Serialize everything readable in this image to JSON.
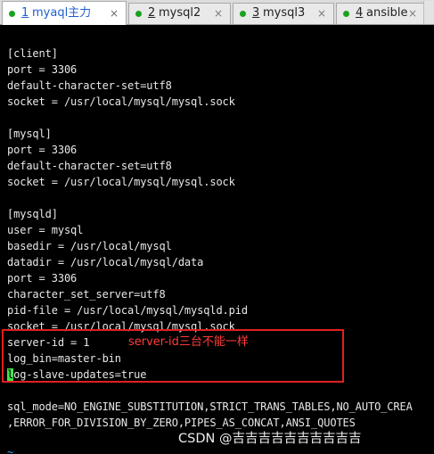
{
  "tabs": [
    {
      "number": "1",
      "label": "myaql主力",
      "active": true,
      "has_close": true
    },
    {
      "number": "2",
      "label": "mysql2",
      "active": false,
      "has_close": true
    },
    {
      "number": "3",
      "label": "mysql3",
      "active": false,
      "has_close": true
    },
    {
      "number": "4",
      "label": "ansible",
      "active": false,
      "has_close": true
    }
  ],
  "tab_close_glyph": "×",
  "status_color": "#1ba21b",
  "terminal": {
    "lines": [
      "[client]",
      "port = 3306",
      "default-character-set=utf8",
      "socket = /usr/local/mysql/mysql.sock",
      "",
      "[mysql]",
      "port = 3306",
      "default-character-set=utf8",
      "socket = /usr/local/mysql/mysql.sock",
      "",
      "[mysqld]",
      "user = mysql",
      "basedir = /usr/local/mysql",
      "datadir = /usr/local/mysql/data",
      "port = 3306",
      "character_set_server=utf8",
      "pid-file = /usr/local/mysql/mysqld.pid",
      "socket = /usr/local/mysql/mysql.sock",
      "server-id = 1",
      "log_bin=master-bin",
      "log-slave-updates=true",
      "",
      "sql_mode=NO_ENGINE_SUBSTITUTION,STRICT_TRANS_TABLES,NO_AUTO_CREA",
      ",ERROR_FOR_DIVISION_BY_ZERO,PIPES_AS_CONCAT,ANSI_QUOTES",
      "",
      "~"
    ],
    "cursor_line_index": 20,
    "cursor_char": "l",
    "cursor_rest": "og-slave-updates=true"
  },
  "annotation": "server-id三台不能一样",
  "watermark": "CSDN @吉吉吉吉吉吉吉吉吉吉",
  "colors": {
    "terminal_bg": "#000000",
    "text": "#e8e8e8",
    "cursor": "#3fe64a",
    "annotation": "#ff3b3b",
    "highlight_border": "#e02020",
    "tilde": "#3aa3ff",
    "active_tab_text": "#1f5fd0"
  }
}
